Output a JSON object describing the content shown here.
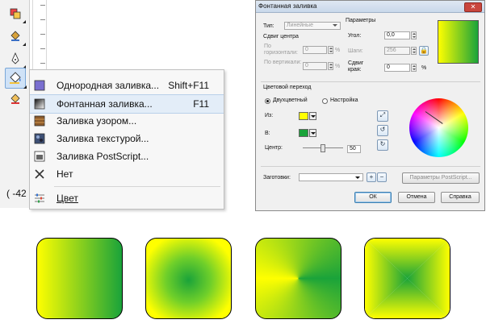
{
  "toolbox": {
    "coordinate": "( -42"
  },
  "menu": {
    "items": [
      {
        "label": "Однородная заливка...",
        "shortcut": "Shift+F11"
      },
      {
        "label": "Фонтанная заливка...",
        "shortcut": "F11"
      },
      {
        "label": "Заливка узором...",
        "shortcut": ""
      },
      {
        "label": "Заливка текстурой...",
        "shortcut": ""
      },
      {
        "label": "Заливка PostScript...",
        "shortcut": ""
      },
      {
        "label": "Нет",
        "shortcut": ""
      },
      {
        "label": "Цвет",
        "shortcut": ""
      }
    ],
    "highlighted_index": 1
  },
  "dialog": {
    "title": "Фонтанная заливка",
    "type_label": "Тип:",
    "type_value": "Линейные",
    "params_label": "Параметры",
    "center_shift_label": "Сдвиг центра",
    "horizontal_label": "По горизонтали:",
    "horizontal_value": "0",
    "vertical_label": "По вертикали:",
    "vertical_value": "0",
    "percent": "%",
    "angle_label": "Угол:",
    "angle_value": "0,0",
    "steps_label": "Шаги:",
    "steps_value": "256",
    "edge_label": "Сдвиг края:",
    "edge_value": "0",
    "transition_label": "Цветовой переход",
    "two_color_label": "Двухцветный",
    "custom_label": "Настройка",
    "from_label": "Из:",
    "to_label": "В:",
    "center_label": "Центр:",
    "center_value": "50",
    "presets_label": "Заготовки:",
    "presets_value": "",
    "postscript_button": "Параметры PostScript...",
    "ok_button": "ОК",
    "cancel_button": "Отмена",
    "help_button": "Справка",
    "colors": {
      "from": "#ffff00",
      "to": "#1aa33a"
    }
  },
  "samples": [
    {
      "name": "linear"
    },
    {
      "name": "radial"
    },
    {
      "name": "conical"
    },
    {
      "name": "square"
    }
  ],
  "accent": {
    "highlight": "#e3edf8",
    "yellow": "#ffff00",
    "green": "#1aa33a"
  }
}
